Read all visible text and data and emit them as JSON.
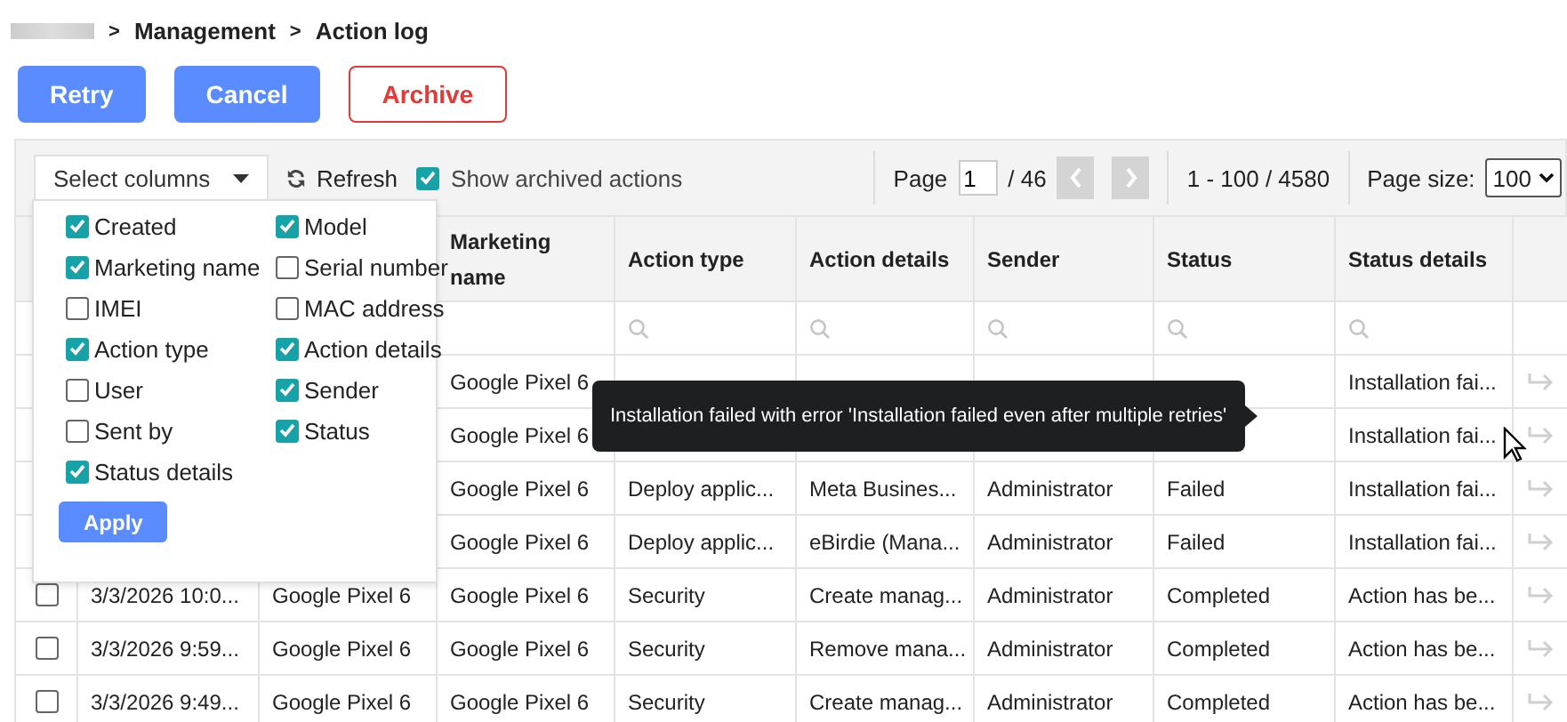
{
  "breadcrumb": {
    "items": [
      "Management",
      "Action log"
    ],
    "separator": ">"
  },
  "actions": [
    {
      "label": "Retry",
      "kind": "primary"
    },
    {
      "label": "Cancel",
      "kind": "primary"
    },
    {
      "label": "Archive",
      "kind": "danger"
    }
  ],
  "toolbar": {
    "select_columns": "Select columns",
    "refresh": "Refresh",
    "show_archived": {
      "label": "Show archived actions",
      "checked": true
    }
  },
  "pager": {
    "page_label": "Page",
    "page": "1",
    "page_total": "/ 46",
    "range": "1 - 100 / 4580",
    "page_size_label": "Page size:",
    "page_size": "100"
  },
  "column_menu": {
    "options": [
      {
        "label": "Created",
        "checked": true
      },
      {
        "label": "Model",
        "checked": true
      },
      {
        "label": "Marketing name",
        "checked": true
      },
      {
        "label": "Serial number",
        "checked": false
      },
      {
        "label": "IMEI",
        "checked": false
      },
      {
        "label": "MAC address",
        "checked": false
      },
      {
        "label": "Action type",
        "checked": true
      },
      {
        "label": "Action details",
        "checked": true
      },
      {
        "label": "User",
        "checked": false
      },
      {
        "label": "Sender",
        "checked": true
      },
      {
        "label": "Sent by",
        "checked": false
      },
      {
        "label": "Status",
        "checked": true
      },
      {
        "label": "Status details",
        "checked": true
      }
    ],
    "apply": "Apply"
  },
  "table": {
    "columns": [
      null,
      null,
      "Marketing name",
      "Action type",
      "Action details",
      "Sender",
      "Status",
      "Status details"
    ],
    "filter_columns": [
      null,
      null,
      false,
      true,
      true,
      true,
      true,
      true
    ],
    "rows": [
      {
        "cells": [
          null,
          null,
          "Google Pixel 6",
          null,
          null,
          null,
          null,
          "Installation fai..."
        ]
      },
      {
        "cells": [
          null,
          null,
          "Google Pixel 6",
          null,
          null,
          null,
          null,
          "Installation fai..."
        ]
      },
      {
        "cells": [
          null,
          null,
          "Google Pixel 6",
          "Deploy applic...",
          "Meta Busines...",
          "Administrator",
          "Failed",
          "Installation fai..."
        ]
      },
      {
        "cells": [
          null,
          null,
          "Google Pixel 6",
          "Deploy applic...",
          "eBirdie (Mana...",
          "Administrator",
          "Failed",
          "Installation fai..."
        ]
      },
      {
        "selected": false,
        "cells": [
          "3/3/2026 10:0...",
          "Google Pixel 6",
          "Google Pixel 6",
          "Security",
          "Create manag...",
          "Administrator",
          "Completed",
          "Action has be..."
        ]
      },
      {
        "selected": false,
        "cells": [
          "3/3/2026 9:59...",
          "Google Pixel 6",
          "Google Pixel 6",
          "Security",
          "Remove mana...",
          "Administrator",
          "Completed",
          "Action has be..."
        ]
      },
      {
        "selected": false,
        "cells": [
          "3/3/2026 9:49...",
          "Google Pixel 6",
          "Google Pixel 6",
          "Security",
          "Create manag...",
          "Administrator",
          "Completed",
          "Action has be..."
        ]
      }
    ]
  },
  "tooltip": "Installation failed with error 'Installation failed even after multiple retries'"
}
